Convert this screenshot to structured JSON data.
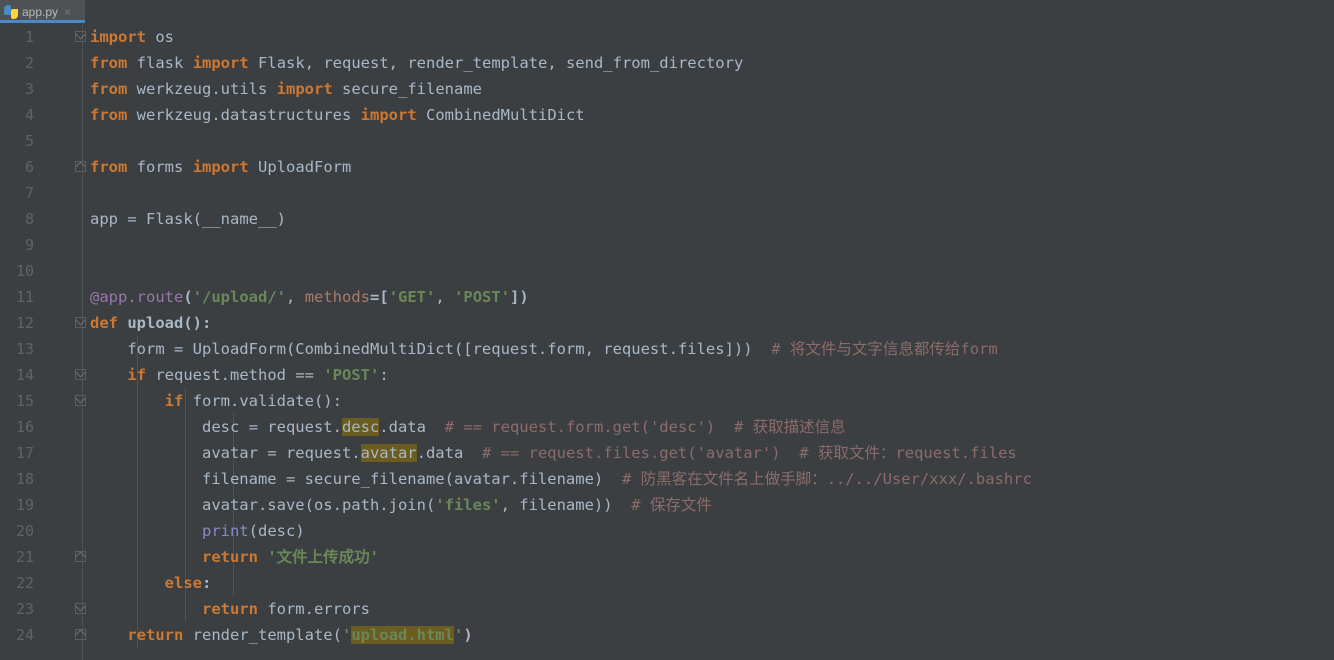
{
  "window": {
    "app": "PyCharm Editor",
    "background": "#3c3f41",
    "accent": "#4a88c7"
  },
  "tabbar": {
    "tabs": [
      {
        "label": "app.py",
        "icon": "python-file-icon",
        "close_label": "×",
        "active": true
      }
    ]
  },
  "editor": {
    "language": "Python",
    "font_size": "15.5px",
    "line_numbers": [
      "1",
      "2",
      "3",
      "4",
      "5",
      "6",
      "7",
      "8",
      "9",
      "10",
      "11",
      "12",
      "13",
      "14",
      "15",
      "16",
      "17",
      "18",
      "19",
      "20",
      "21",
      "22",
      "23",
      "24"
    ],
    "lines": [
      {
        "n": "1",
        "text": "import os"
      },
      {
        "n": "2",
        "text": "from flask import Flask, request, render_template, send_from_directory"
      },
      {
        "n": "3",
        "text": "from werkzeug.utils import secure_filename"
      },
      {
        "n": "4",
        "text": "from werkzeug.datastructures import CombinedMultiDict"
      },
      {
        "n": "5",
        "text": ""
      },
      {
        "n": "6",
        "text": "from forms import UploadForm"
      },
      {
        "n": "7",
        "text": ""
      },
      {
        "n": "8",
        "text": "app = Flask(__name__)"
      },
      {
        "n": "9",
        "text": ""
      },
      {
        "n": "10",
        "text": ""
      },
      {
        "n": "11",
        "text": "@app.route('/upload/', methods=['GET', 'POST'])"
      },
      {
        "n": "12",
        "text": "def upload():"
      },
      {
        "n": "13",
        "text": "    form = UploadForm(CombinedMultiDict([request.form, request.files]))  # 将文件与文字信息都传给form"
      },
      {
        "n": "14",
        "text": "    if request.method == 'POST':"
      },
      {
        "n": "15",
        "text": "        if form.validate():"
      },
      {
        "n": "16",
        "text": "            desc = request.desc.data  # == request.form.get('desc')  # 获取描述信息"
      },
      {
        "n": "17",
        "text": "            avatar = request.avatar.data  # == request.files.get('avatar')  # 获取文件：request.files"
      },
      {
        "n": "18",
        "text": "            filename = secure_filename(avatar.filename)  # 防黑客在文件名上做手脚：../../User/xxx/.bashrc"
      },
      {
        "n": "19",
        "text": "            avatar.save(os.path.join('files', filename))  # 保存文件"
      },
      {
        "n": "20",
        "text": "            print(desc)"
      },
      {
        "n": "21",
        "text": "            return '文件上传成功'"
      },
      {
        "n": "22",
        "text": "        else:"
      },
      {
        "n": "23",
        "text": "            return form.errors"
      },
      {
        "n": "24",
        "text": "    return render_template('upload.html')"
      }
    ],
    "tokens": {
      "l1": {
        "kw": "import",
        "id": "os"
      },
      "l2": {
        "kw1": "from",
        "mod": "flask",
        "kw2": "import",
        "names": "Flask, request, render_template, send_from_directory"
      },
      "l3": {
        "kw1": "from",
        "mod": "werkzeug.utils",
        "kw2": "import",
        "names": "secure_filename"
      },
      "l4": {
        "kw1": "from",
        "mod": "werkzeug.datastructures",
        "kw2": "import",
        "names": "CombinedMultiDict"
      },
      "l6": {
        "kw1": "from",
        "mod": "forms",
        "kw2": "import",
        "names": "UploadForm"
      },
      "l8": {
        "target": "app",
        "eq": " = ",
        "call": "Flask(",
        "arg": "__name__",
        "close": ")"
      },
      "l11": {
        "at": "@",
        "deco": "app.route",
        "open": "(",
        "path": "'/upload/'",
        "comma": ", ",
        "kwarg": "methods",
        "eq": "=[",
        "s1": "'GET'",
        "c2": ", ",
        "s2": "'POST'",
        "close": "])"
      },
      "l12": {
        "kw": "def",
        "name": " upload",
        "rest": "():"
      },
      "l13": {
        "indent": "    ",
        "a": "form = UploadForm(CombinedMultiDict([request.form, request.files]))",
        "gap": "  ",
        "cmt": "# 将文件与文字信息都传给form"
      },
      "l14": {
        "indent": "    ",
        "kw": "if",
        "a": " request.method == ",
        "s": "'POST'",
        "b": ":"
      },
      "l15": {
        "indent": "        ",
        "kw": "if",
        "a": " form.validate():"
      },
      "l16": {
        "indent": "            ",
        "a": "desc = request.",
        "hl": "desc",
        "b": ".data",
        "gap": "  ",
        "cmt1": "# == request.form.get('desc')",
        "gap2": "  ",
        "cmt2": "# 获取描述信息"
      },
      "l17": {
        "indent": "            ",
        "a": "avatar = request.",
        "hl": "avatar",
        "b": ".data",
        "gap": "  ",
        "cmt1": "# == request.files.get('avatar')",
        "gap2": "  ",
        "cmt2": "# 获取文件：request.files"
      },
      "l18": {
        "indent": "            ",
        "a": "filename = secure_filename(avatar.filename)",
        "gap": "  ",
        "cmt": "# 防黑客在文件名上做手脚：../../User/xxx/.bashrc"
      },
      "l19": {
        "indent": "            ",
        "a": "avatar.save(os.path.join(",
        "s": "'files'",
        "b": ", filename))",
        "gap": "  ",
        "cmt": "# 保存文件"
      },
      "l20": {
        "indent": "            ",
        "fn": "print",
        "rest": "(desc)"
      },
      "l21": {
        "indent": "            ",
        "kw": "return",
        "s": " '文件上传成功'"
      },
      "l22": {
        "indent": "        ",
        "kw": "else",
        "rest": ":"
      },
      "l23": {
        "indent": "            ",
        "kw": "return",
        "rest": " form.errors"
      },
      "l24": {
        "indent": "    ",
        "kw": "return",
        "a": " render_template(",
        "q1": "'",
        "hl": "upload.html",
        "q2": "'",
        "b": ")"
      }
    },
    "gutter_folds": [
      {
        "line": "1",
        "type": "fold-collapse-down-icon"
      },
      {
        "line": "6",
        "type": "fold-collapse-up-icon"
      },
      {
        "line": "12",
        "type": "fold-collapse-down-icon"
      },
      {
        "line": "14",
        "type": "fold-collapse-down-icon"
      },
      {
        "line": "15",
        "type": "fold-collapse-down-icon"
      },
      {
        "line": "21",
        "type": "fold-collapse-up-icon"
      },
      {
        "line": "23",
        "type": "fold-collapse-down-icon"
      },
      {
        "line": "24",
        "type": "fold-collapse-up-icon"
      }
    ]
  },
  "colors": {
    "background": "#3c3f41",
    "gutter_text": "#606366",
    "default_text": "#a9b7c6",
    "keyword": "#cc7832",
    "string": "#6a8759",
    "comment": "#8c6b6b",
    "decorator": "#bbb529",
    "builtin": "#8888c6",
    "kwarg": "#aa7b6a",
    "highlight": "#6b5c1f",
    "tab_active_bg": "#4e5254",
    "tab_underline": "#4a88c7"
  }
}
